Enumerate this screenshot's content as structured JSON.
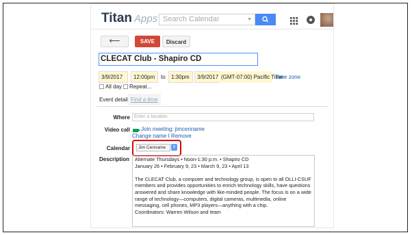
{
  "header": {
    "logo_main": "Titan",
    "logo_sub": "Apps",
    "search_placeholder": "Search Calendar"
  },
  "toolbar": {
    "back_label": "⟵",
    "save_label": "SAVE",
    "discard_label": "Discard"
  },
  "event": {
    "title": "CLECAT Club - Shapiro CD",
    "start_date": "3/9/2017",
    "start_time": "12:00pm",
    "to_label": "to",
    "end_time": "1:30pm",
    "end_date": "3/9/2017",
    "timezone": "(GMT-07:00) Pacific Time",
    "timezone_link": "Time zone",
    "allday_label": "All day",
    "repeat_label": "Repeat..."
  },
  "tabs": [
    {
      "label": "Event details"
    },
    {
      "label": "Find a time"
    }
  ],
  "details": {
    "where_label": "Where",
    "where_placeholder": "Enter a location",
    "video_label": "Video call",
    "video_link": "Join meeting: jimcenname",
    "video_change": "Change name I Remove",
    "calendar_label": "Calendar",
    "calendar_value": "Jim Cenname",
    "description_label": "Description",
    "description_lines": [
      "Alternate Thursdays • Noon-1:30 p.m. • Shapiro CD",
      "January 26 • February 9, 23 • March 9, 23 • April 13",
      "",
      "The CLECAT Club, a computer and technology group, is open to all OLLI-CSUF members and provides opportunities to enrich technology skills, have questions answered and share knowledge with like-minded people. The focus is on a wide range of technology—computers, digital cameras, multimedia, online messaging, cell phones, MP3 players—anything with a chip.",
      "Coordinators: Warren Wilson and team"
    ]
  },
  "colors": {
    "accent": "#4a8af4",
    "save": "#d14836",
    "highlight": "#fff7d1",
    "annotation": "#e00000"
  }
}
